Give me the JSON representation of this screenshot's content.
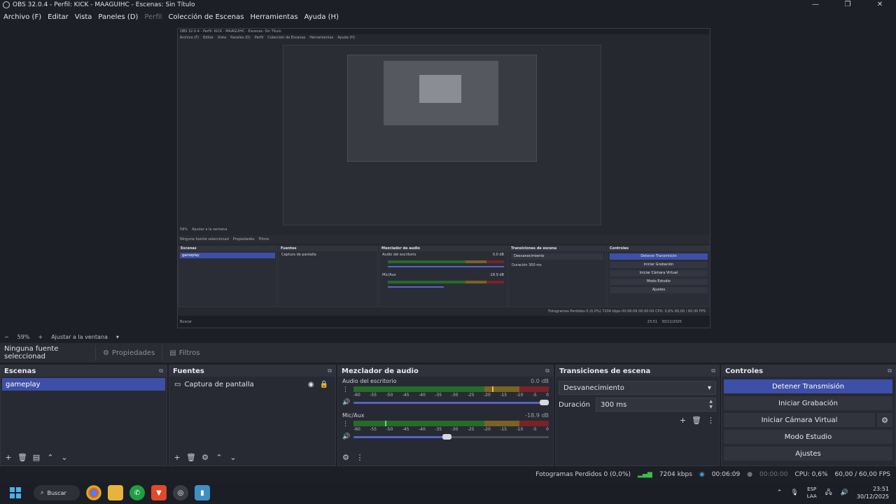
{
  "window": {
    "title": "OBS 32.0.4 - Perfil: KICK - MAAGUIHC - Escenas: Sin Título",
    "controls": [
      "—",
      "❐",
      "✕"
    ]
  },
  "menu": [
    "Archivo (F)",
    "Editar",
    "Vista",
    "Paneles (D)",
    "Perfil",
    "Colección de Escenas",
    "Herramientas",
    "Ayuda (H)"
  ],
  "zoom": {
    "minus": "−",
    "value": "59%",
    "plus": "+",
    "fit": "Ajustar a la ventana"
  },
  "source_toolbar": {
    "no_source": "Ninguna fuente seleccionad",
    "properties": "Propiedades",
    "filters": "Filtros"
  },
  "scenes": {
    "title": "Escenas",
    "items": [
      "gameplay"
    ]
  },
  "sources": {
    "title": "Fuentes",
    "items": [
      "Captura de pantalla"
    ]
  },
  "mixer": {
    "title": "Mezclador de audio",
    "channels": [
      {
        "name": "Audio del escritorio",
        "db": "0.0 dB",
        "peak": 0.71,
        "volume": 1.0
      },
      {
        "name": "Mic/Aux",
        "db": "-18.9 dB",
        "peak": 0.16,
        "volume": 0.5
      }
    ],
    "ticks": [
      "-60",
      "-55",
      "-50",
      "-45",
      "-40",
      "-35",
      "-30",
      "-25",
      "-20",
      "-15",
      "-10",
      "-5",
      "0"
    ]
  },
  "transitions": {
    "title": "Transiciones de escena",
    "selected": "Desvanecimiento",
    "duration_label": "Duración",
    "duration_value": "300 ms"
  },
  "controls": {
    "title": "Controles",
    "stop_stream": "Detener Transmisión",
    "start_recording": "Iniciar Grabación",
    "start_virtual_cam": "Iniciar Cámara Virtual",
    "studio_mode": "Modo Estudio",
    "settings": "Ajustes"
  },
  "status": {
    "dropped": "Fotogramas Perdidos 0 (0,0%)",
    "bitrate": "7204 kbps",
    "stream_time": "00:06:09",
    "rec_time": "00:00:00",
    "cpu": "CPU: 0,6%",
    "fps": "60,00 / 60,00 FPS"
  },
  "taskbar": {
    "search": "Buscar",
    "lang_top": "ESP",
    "lang_bottom": "LAA",
    "time": "23:51",
    "date": "30/12/2025"
  },
  "preview_mini": {
    "title": "OBS 32.0.4 - Perfil: KICK - MAAGUIHC - Escenas: Sin Título",
    "menu": [
      "Archivo (F)",
      "Editar",
      "Vista",
      "Paneles (D)",
      "Perfil",
      "Colección de Escenas",
      "Herramientas",
      "Ayuda (H)"
    ],
    "zoom": "59%",
    "fit": "Ajustar a la ventana",
    "no_source": "Ninguna fuente seleccionad",
    "properties": "Propiedades",
    "filters": "Filtros",
    "scenes": "Escenas",
    "scene": "gameplay",
    "sources": "Fuentes",
    "source": "Captura de pantalla",
    "mixer": "Mezclador de audio",
    "ch1": "Audio del escritorio",
    "ch1_db": "0.0 dB",
    "ch2": "Mic/Aux",
    "ch2_db": "-18.9 dB",
    "transitions": "Transiciones de escena",
    "transition": "Desvanecimiento",
    "duration_label": "Duración",
    "duration": "300 ms",
    "controls": "Controles",
    "buttons": [
      "Detener Transmisión",
      "Iniciar Grabación",
      "Iniciar Cámara Virtual",
      "Modo Estudio",
      "Ajustes"
    ],
    "status": "Fotogramas Perdidos 0 (0,0%)   7204 kbps   00:06:09   00:00:00   CPU: 0,6%   60,00 / 60,00 FPS",
    "search": "Buscar",
    "time": "23:51",
    "date": "30/12/2025"
  },
  "colors": {
    "accent": "#3e4fa7",
    "background": "#1d1f26",
    "dock": "#272a33",
    "ok": "#3cbd4a"
  }
}
